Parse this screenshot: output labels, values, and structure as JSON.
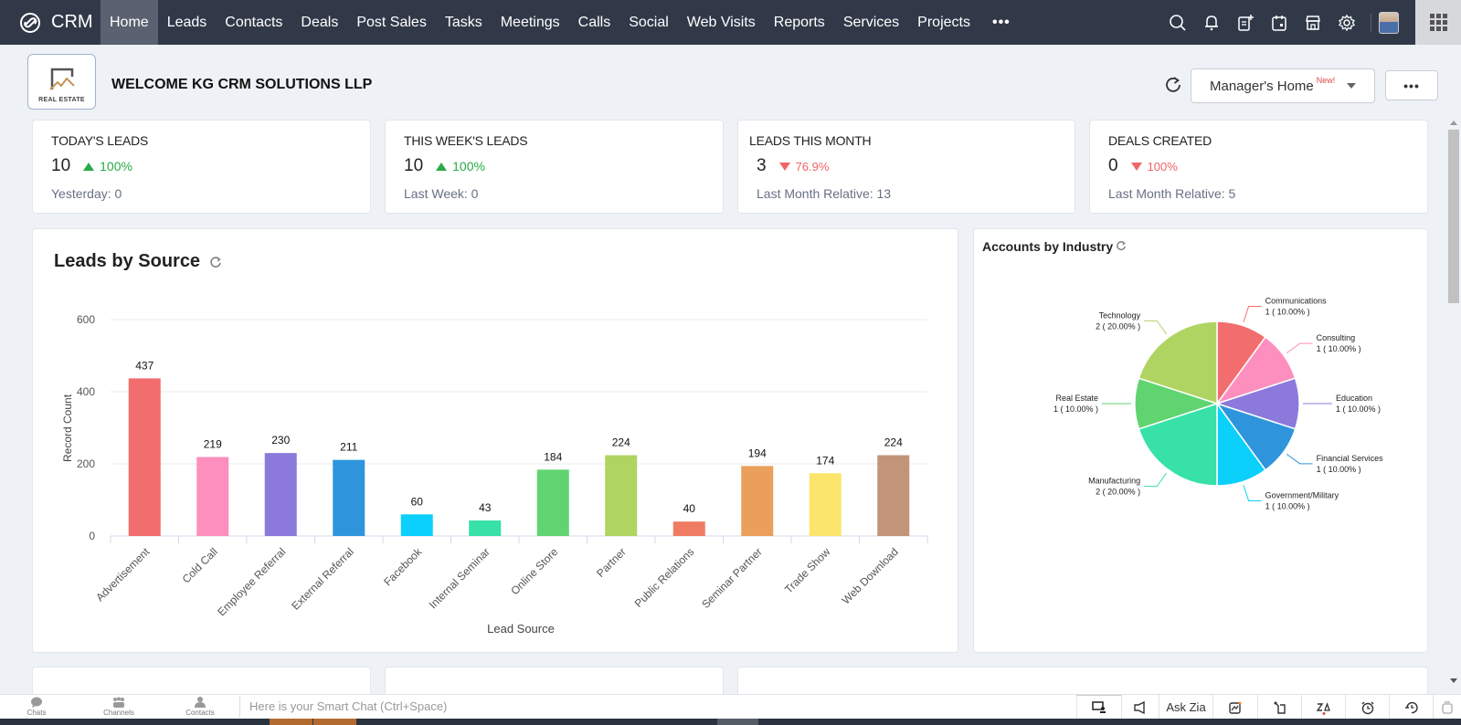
{
  "app": {
    "brand": "CRM"
  },
  "nav": {
    "tabs": [
      {
        "label": "Home",
        "active": true
      },
      {
        "label": "Leads"
      },
      {
        "label": "Contacts"
      },
      {
        "label": "Deals"
      },
      {
        "label": "Post Sales"
      },
      {
        "label": "Tasks"
      },
      {
        "label": "Meetings"
      },
      {
        "label": "Calls"
      },
      {
        "label": "Social"
      },
      {
        "label": "Web Visits"
      },
      {
        "label": "Reports"
      },
      {
        "label": "Services"
      },
      {
        "label": "Projects"
      }
    ],
    "more_label": "•••",
    "icons": [
      "search-icon",
      "bell-icon",
      "add-note-icon",
      "calendar-icon",
      "marketplace-icon",
      "gear-icon"
    ]
  },
  "header": {
    "logo_text": "REAL ESTATE",
    "welcome": "WELCOME KG CRM SOLUTIONS LLP",
    "home_select": {
      "label": "Manager's Home",
      "badge": "New!"
    },
    "more_label": "•••"
  },
  "kpis": [
    {
      "title": "TODAY'S LEADS",
      "value": "10",
      "trend": "up",
      "pct": "100%",
      "sub": "Yesterday: 0"
    },
    {
      "title": "THIS WEEK'S LEADS",
      "value": "10",
      "trend": "up",
      "pct": "100%",
      "sub": "Last Week: 0"
    },
    {
      "title": "LEADS THIS MONTH",
      "value": "3",
      "trend": "down",
      "pct": "76.9%",
      "sub": "Last Month Relative: 13"
    },
    {
      "title": "DEALS CREATED",
      "value": "0",
      "trend": "down",
      "pct": "100%",
      "sub": "Last Month Relative: 5"
    }
  ],
  "colors": {
    "up": "#2aa948",
    "down": "#f06565",
    "nav_bg": "#313949"
  },
  "chart_data": [
    {
      "type": "bar",
      "title": "Leads by Source",
      "xlabel": "Lead Source",
      "ylabel": "Record Count",
      "ylim": [
        0,
        600
      ],
      "yticks": [
        0,
        200,
        400,
        600
      ],
      "grid": true,
      "categories": [
        "Advertisement",
        "Cold Call",
        "Employee Referral",
        "External Referral",
        "Facebook",
        "Internal Seminar",
        "Online Store",
        "Partner",
        "Public Relations",
        "Seminar Partner",
        "Trade Show",
        "Web Download"
      ],
      "values": [
        437,
        219,
        230,
        211,
        60,
        43,
        184,
        224,
        40,
        194,
        174,
        224
      ],
      "colors": [
        "#f26d6d",
        "#fd8fbe",
        "#8b79db",
        "#2e95dc",
        "#0ad0fb",
        "#37e1a8",
        "#60d470",
        "#afd462",
        "#ef7b63",
        "#eaa05a",
        "#fbe56b",
        "#c2957a"
      ]
    },
    {
      "type": "pie",
      "title": "Accounts by Industry",
      "slices": [
        {
          "label": "Communications",
          "value": 1,
          "pct": "10.00%",
          "color": "#f26d6d"
        },
        {
          "label": "Consulting",
          "value": 1,
          "pct": "10.00%",
          "color": "#fd8fbe"
        },
        {
          "label": "Education",
          "value": 1,
          "pct": "10.00%",
          "color": "#8b79db"
        },
        {
          "label": "Financial Services",
          "value": 1,
          "pct": "10.00%",
          "color": "#2e95dc"
        },
        {
          "label": "Government/Military",
          "value": 1,
          "pct": "10.00%",
          "color": "#0ad0fb"
        },
        {
          "label": "Manufacturing",
          "value": 2,
          "pct": "20.00%",
          "color": "#37e1a8"
        },
        {
          "label": "Real Estate",
          "value": 1,
          "pct": "10.00%",
          "color": "#60d470"
        },
        {
          "label": "Technology",
          "value": 2,
          "pct": "20.00%",
          "color": "#afd462"
        }
      ]
    }
  ],
  "bottombar": {
    "items": [
      {
        "label": "Chats"
      },
      {
        "label": "Channels"
      },
      {
        "label": "Contacts"
      }
    ],
    "smartchat_placeholder": "Here is your Smart Chat (Ctrl+Space)",
    "ask_zia": "Ask Zia"
  }
}
